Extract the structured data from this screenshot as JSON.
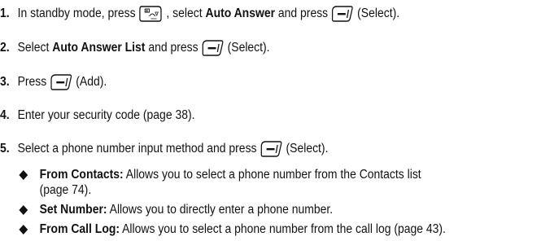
{
  "steps": [
    {
      "number": "1.",
      "text_before": "In standby mode, press",
      "text_mid": ", select",
      "bold": "Auto Answer",
      "text_after": "and press",
      "text_end": "(Select)."
    },
    {
      "number": "2.",
      "text_before": "Select",
      "bold": "Auto Answer List",
      "text_after": "and press",
      "text_end": "(Select)."
    },
    {
      "number": "3.",
      "text_before": "Press",
      "text_end": "(Add)."
    },
    {
      "number": "4.",
      "text": "Enter your security code (page 38)."
    },
    {
      "number": "5.",
      "text_before": "Select a phone number input method and press",
      "text_end": "(Select)."
    }
  ],
  "options": [
    {
      "label": "From Contacts:",
      "text": "Allows you to select a phone number from the Contacts list",
      "continuation": "(page 74)."
    },
    {
      "label": "Set Number:",
      "text": "Allows you to directly enter a phone number."
    },
    {
      "label": "From Call Log:",
      "text": "Allows you to select a phone number from the call log (page 43)."
    }
  ],
  "icons": {
    "menu_key": "menu-key-icon",
    "softkey": "left-softkey-icon",
    "bullet": "diamond-bullet-icon"
  }
}
